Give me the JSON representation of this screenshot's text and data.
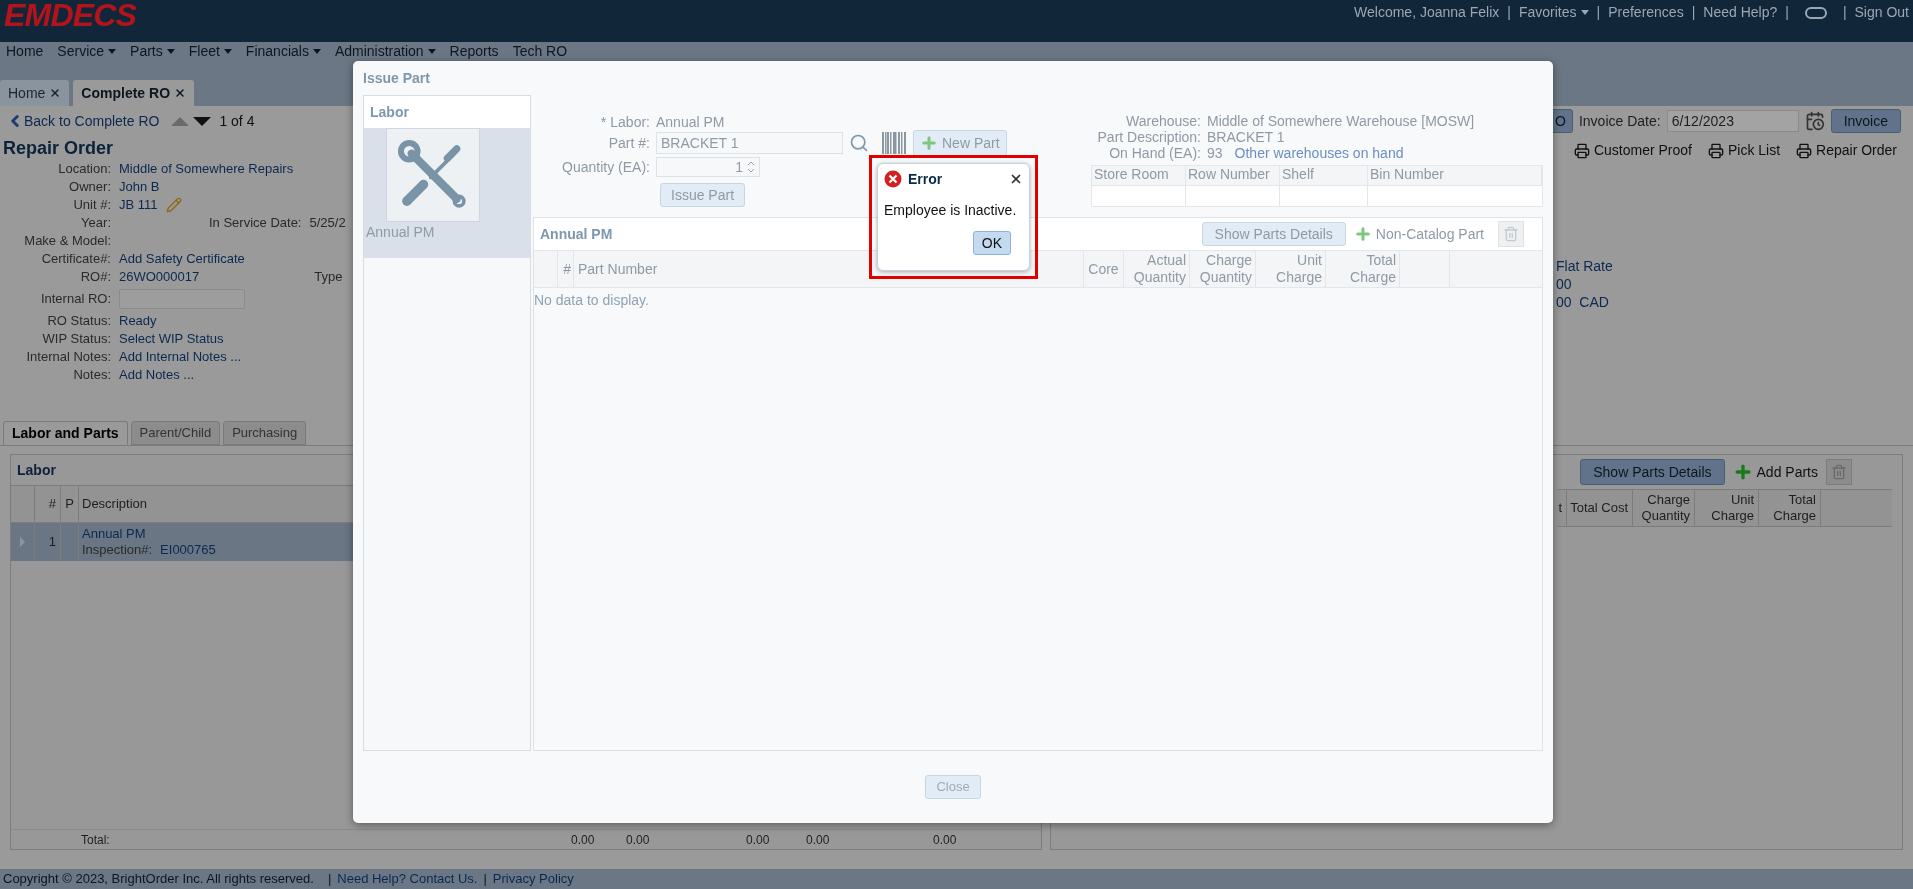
{
  "header": {
    "logo": "EMDECS",
    "separator": "|",
    "links": [
      {
        "kind": "text",
        "label": "Welcome, Joanna Felix"
      },
      {
        "kind": "dropdown",
        "label": "Favorites"
      },
      {
        "kind": "link",
        "label": "Preferences"
      },
      {
        "kind": "link",
        "label": "Need Help?"
      },
      {
        "kind": "icon"
      },
      {
        "kind": "link",
        "label": "Sign Out"
      }
    ]
  },
  "menu": [
    {
      "label": "Home",
      "dropdown": false
    },
    {
      "label": "Service",
      "dropdown": true
    },
    {
      "label": "Parts",
      "dropdown": true
    },
    {
      "label": "Fleet",
      "dropdown": true
    },
    {
      "label": "Financials",
      "dropdown": true
    },
    {
      "label": "Administration",
      "dropdown": true
    },
    {
      "label": "Reports",
      "dropdown": false
    },
    {
      "label": "Tech RO",
      "dropdown": false
    }
  ],
  "page_tabs": [
    {
      "label": "Home",
      "selected": false
    },
    {
      "label": "Complete RO",
      "selected": true
    }
  ],
  "toolbar": {
    "back": "Back to Complete RO",
    "position": "1 of 4",
    "ro_button": "O",
    "invoice_date_label": "Invoice Date:",
    "invoice_date": "6/12/2023",
    "invoice_button": "Invoice"
  },
  "print_buttons": [
    "Customer Proof",
    "Pick List",
    "Repair Order"
  ],
  "repair_order": {
    "title": "Repair Order",
    "fields": [
      {
        "label": "Location:",
        "kind": "text",
        "value": "Middle of Somewhere Repairs"
      },
      {
        "label": "Owner:",
        "kind": "text",
        "value": "John B"
      },
      {
        "label": "Unit #:",
        "kind": "editable",
        "value": "JB 111"
      },
      {
        "label": "Year:",
        "kind": "text",
        "side_label": "In Service Date:",
        "side_value": "5/25/2"
      },
      {
        "label": "Make & Model:",
        "kind": "text"
      },
      {
        "label": "Certificate#:",
        "kind": "text",
        "value": "Add Safety Certificate"
      },
      {
        "label": "RO#:",
        "kind": "text",
        "value": "26WO000017",
        "side_label": "Type"
      },
      {
        "label": "Internal RO:",
        "kind": "input"
      },
      {
        "label": "RO Status:",
        "kind": "text",
        "value": "Ready"
      },
      {
        "label": "WIP Status:",
        "kind": "text",
        "value": "Select WIP Status"
      },
      {
        "label": "Internal Notes:",
        "kind": "text",
        "value": "Add Internal Notes ..."
      },
      {
        "label": "Notes:",
        "kind": "text",
        "value": "Add Notes ..."
      }
    ]
  },
  "rate_texts": [
    "Flat Rate",
    "00",
    "00  CAD"
  ],
  "detail_tabs": [
    {
      "label": "Labor and Parts",
      "selected": true
    },
    {
      "label": "Parent/Child",
      "selected": false
    },
    {
      "label": "Purchasing",
      "selected": false
    }
  ],
  "labor_panel": {
    "title": "Labor",
    "columns": [
      "#",
      "P",
      "Description"
    ],
    "rows": [
      {
        "number": "1",
        "description": "Annual PM",
        "inspection_label": "Inspection#:",
        "inspection": "EI000765",
        "selected": true
      }
    ],
    "total_label": "Total:",
    "totals": [
      "0.00",
      "0.00",
      "0.00",
      "0.00",
      "0.00"
    ]
  },
  "parts_panel": {
    "show_details": "Show Parts Details",
    "add_parts": "Add Parts",
    "columns": [
      "t",
      "Total Cost",
      "Charge Quantity",
      "Unit Charge",
      "Total Charge"
    ]
  },
  "footer": {
    "copyright": "Copyright © 2023, BrightOrder Inc. All rights reserved.",
    "separator": "|",
    "links": [
      "Need Help? Contact Us.",
      "Privacy Policy"
    ]
  },
  "modal": {
    "title": "Issue Part",
    "labor_list": {
      "title": "Labor",
      "items": [
        {
          "label": "Annual PM",
          "selected": true
        }
      ]
    },
    "form": {
      "required_mark": "*",
      "labor_label": "Labor:",
      "labor": "Annual PM",
      "part_label": "Part #:",
      "part": "BRACKET 1",
      "quantity_label": "Quantity (EA):",
      "quantity": "1",
      "issue_button": "Issue Part",
      "new_part_button": "New Part"
    },
    "warehouse": {
      "fields": [
        {
          "label": "Warehouse:",
          "value": "Middle of Somewhere Warehouse [MOSW]"
        },
        {
          "label": "Part Description:",
          "value": "BRACKET 1"
        },
        {
          "label": "On Hand (EA):",
          "value": "93",
          "link": "Other warehouses on hand"
        }
      ],
      "columns": [
        "Store Room",
        "Row Number",
        "Shelf",
        "Bin Number"
      ]
    },
    "grid": {
      "title": "Annual PM",
      "show_details": "Show Parts Details",
      "non_catalog": "Non-Catalog Part",
      "columns": [
        "#",
        "Part Number",
        "Core",
        "Actual Quantity",
        "Charge Quantity",
        "Unit Charge",
        "Total Charge"
      ],
      "empty": "No data to display."
    },
    "close_button": "Close"
  },
  "error": {
    "title": "Error",
    "message": "Employee is Inactive.",
    "ok": "OK"
  }
}
